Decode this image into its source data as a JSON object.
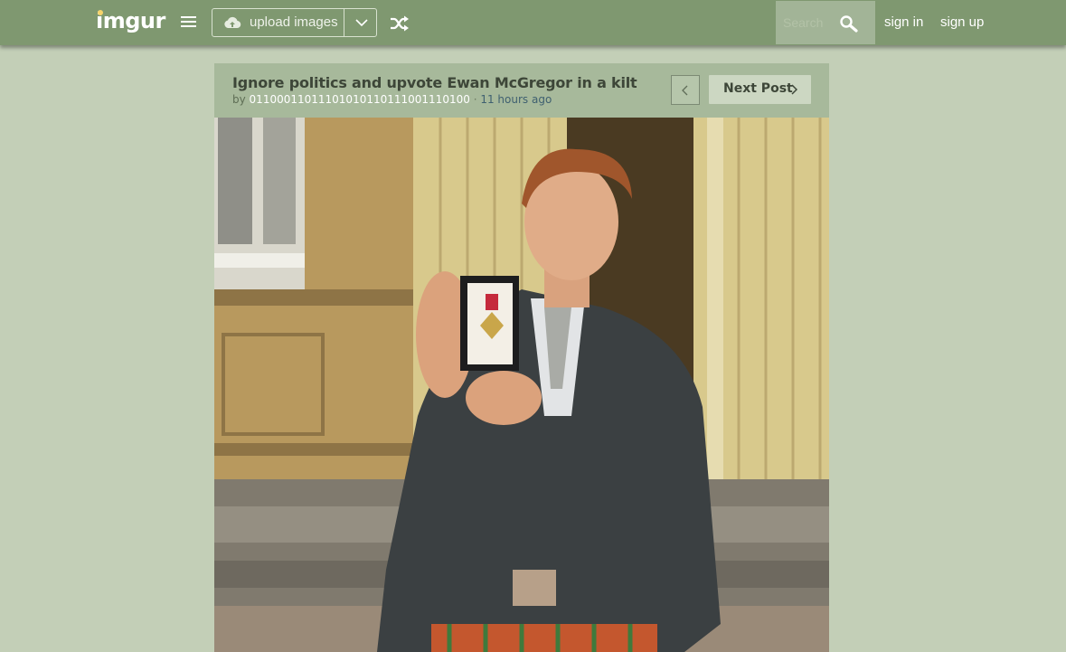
{
  "header": {
    "logo": "imgur",
    "upload_label": "upload images",
    "search_placeholder": "Search",
    "sign_in": "sign in",
    "sign_up": "sign up"
  },
  "post": {
    "title": "Ignore politics and upvote Ewan McGregor in a kilt",
    "by_label": "by",
    "author": "01100011011101010110111001110100",
    "separator": "·",
    "time": "11 hours ago",
    "next_label": "Next Post",
    "image_icon": "photo-of-man-with-medal"
  },
  "colors": {
    "topbar": "#7f9870",
    "page_background": "#c3cfb7",
    "post_header": "#a7b99b",
    "time_text": "#3f6070"
  }
}
